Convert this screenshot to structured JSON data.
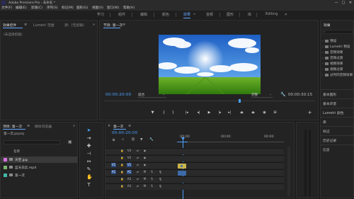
{
  "titlebar": {
    "title": "Adobe Premiere Pro - 未命名 *",
    "min": "—",
    "max": "□",
    "close": "✕"
  },
  "menu": [
    "文件(F)",
    "编辑(E)",
    "剪辑(C)",
    "序列(S)",
    "标记(M)",
    "图形(G)",
    "视图(V)",
    "窗口(W)",
    "帮助(H)"
  ],
  "workspaces": [
    "学习",
    "组件",
    "编辑",
    "颜色",
    "效果",
    "音频",
    "图形",
    "库",
    "Editing"
  ],
  "effect_controls": {
    "tabs": [
      "效果控件",
      "Lumetri 范围",
      "源：(无剪辑)"
    ],
    "no_clip": "(未选择剪辑)"
  },
  "program": {
    "title": "节目: 第一次",
    "tc_left": "00:00:20:00",
    "fit": "适合",
    "quality": "完整",
    "tc_right": "00:00:30:15"
  },
  "project": {
    "tabs": [
      "项目: 第一次",
      "媒体浏览器"
    ],
    "filename": "第一次.prproj",
    "col_name": "名称",
    "items": [
      "天空.jpg",
      "蓝天白云.mp4",
      "第一次"
    ]
  },
  "timeline": {
    "title": "第一次",
    "tc": "00:00:20:00",
    "ruler_start": ":00:00",
    "ruler_mid": "00:00:",
    "ruler_end": "00:00:",
    "tracks": [
      {
        "id": "V3",
        "label": "V3"
      },
      {
        "id": "V2",
        "label": "V2"
      },
      {
        "id": "V1",
        "label": "V1",
        "src": "V1"
      },
      {
        "id": "A1",
        "label": "A1",
        "src": "A1",
        "m": "M",
        "s": "S"
      },
      {
        "id": "A2",
        "label": "A2",
        "m": "M",
        "s": "S"
      },
      {
        "id": "A3",
        "label": "A3",
        "m": "M",
        "s": "S"
      }
    ]
  },
  "effects_panel": {
    "title": "效果",
    "items": [
      "预设",
      "Lumetri 预设",
      "音频效果",
      "音频过渡",
      "视频效果",
      "视频过渡",
      "过时的音频效果"
    ],
    "sections": [
      "基本图形",
      "基本声音",
      "Lumetri 颜色",
      "库",
      "标记",
      "历史记录",
      "信息"
    ]
  },
  "colors": {
    "accent": "#4aa3ff",
    "audio_green": "#2f8f3a",
    "clip_blue": "#3d6aa8"
  }
}
